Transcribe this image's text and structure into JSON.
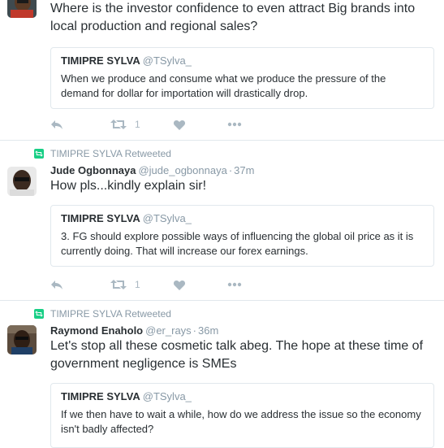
{
  "tweets": [
    {
      "retweeted_by": "",
      "name": "",
      "handle": "",
      "time": "",
      "text": "Where is the investor confidence to even attract Big brands into local production and regional sales?",
      "quote": {
        "name": "TIMIPRE SYLVA",
        "handle": "@TSylva_",
        "text": "When we produce and consume what we produce the pressure of the demand for dollar for importation will drastically drop."
      },
      "retweet_count": "1"
    },
    {
      "retweeted_by": "TIMIPRE SYLVA Retweeted",
      "name": "Jude Ogbonnaya",
      "handle": "@jude_ogbonnaya",
      "time": "37m",
      "text": "How pls...kindly explain sir!",
      "quote": {
        "name": "TIMIPRE SYLVA",
        "handle": "@TSylva_",
        "text": "3. FG should explore possible ways of influencing the global oil price as it is currently doing. That will increase our forex earnings."
      },
      "retweet_count": "1"
    },
    {
      "retweeted_by": "TIMIPRE SYLVA Retweeted",
      "name": "Raymond Enaholo",
      "handle": "@er_rays",
      "time": "36m",
      "text": "Let's stop all these cosmetic talk abeg. The hope at these time of government negligence is SMEs",
      "quote": {
        "name": "TIMIPRE SYLVA",
        "handle": "@TSylva_",
        "text": "If we then have to wait a while, how do we address the issue so the economy isn't badly affected?"
      }
    }
  ],
  "icons": {
    "retweeted": "retweet-icon",
    "reply": "reply-icon",
    "retweet": "retweet-icon",
    "like": "heart-icon",
    "more": "more-icon"
  },
  "colors": {
    "retweet_green": "#19cf86",
    "icon_gray": "#aab8c2",
    "muted_text": "#8899a6",
    "border": "#e1e8ed"
  }
}
